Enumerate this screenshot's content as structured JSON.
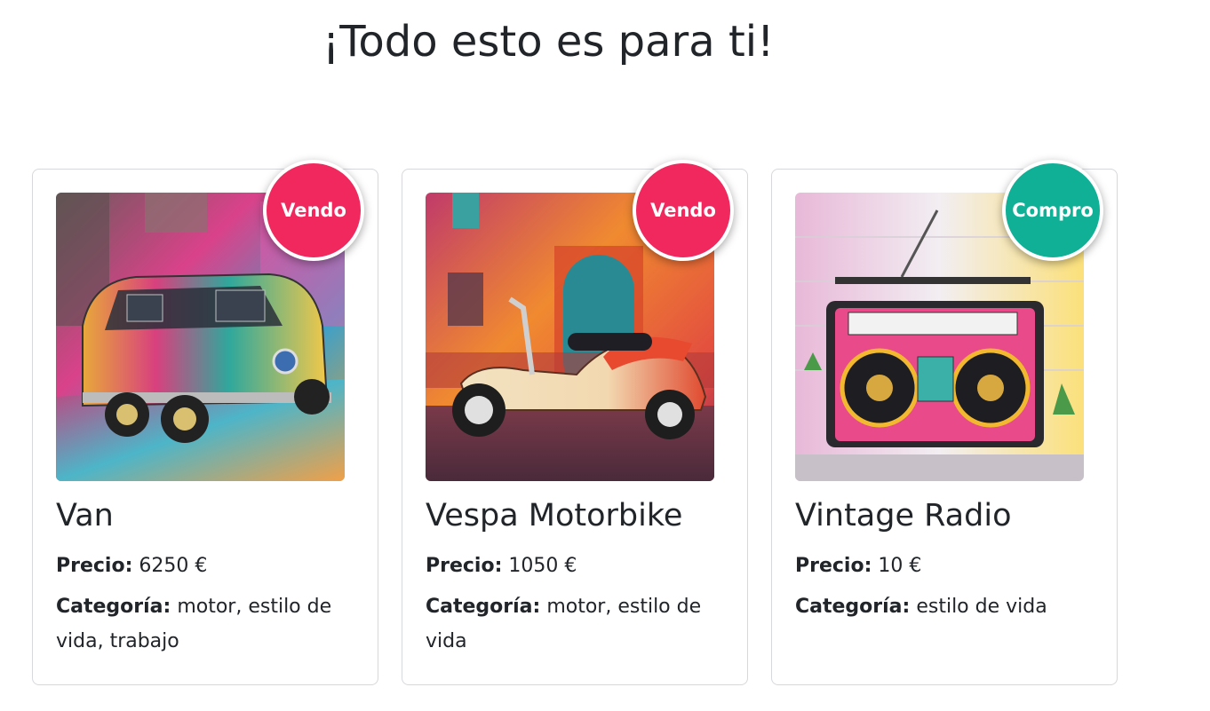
{
  "header": {
    "title": "¡Todo esto es para ti!"
  },
  "colors": {
    "sell_badge": "#f0285e",
    "buy_badge": "#10b097"
  },
  "products": [
    {
      "badge": "Vendo",
      "title": "Van",
      "price_label": "Precio:",
      "price": "6250 €",
      "category_label": "Categoría:",
      "category": "motor, estilo de vida, trabajo"
    },
    {
      "badge": "Vendo",
      "title": "Vespa Motorbike",
      "price_label": "Precio:",
      "price": "1050 €",
      "category_label": "Categoría:",
      "category": "motor, estilo de vida"
    },
    {
      "badge": "Compro",
      "title": "Vintage Radio",
      "price_label": "Precio:",
      "price": "10 €",
      "category_label": "Categoría:",
      "category": "estilo de vida"
    }
  ]
}
